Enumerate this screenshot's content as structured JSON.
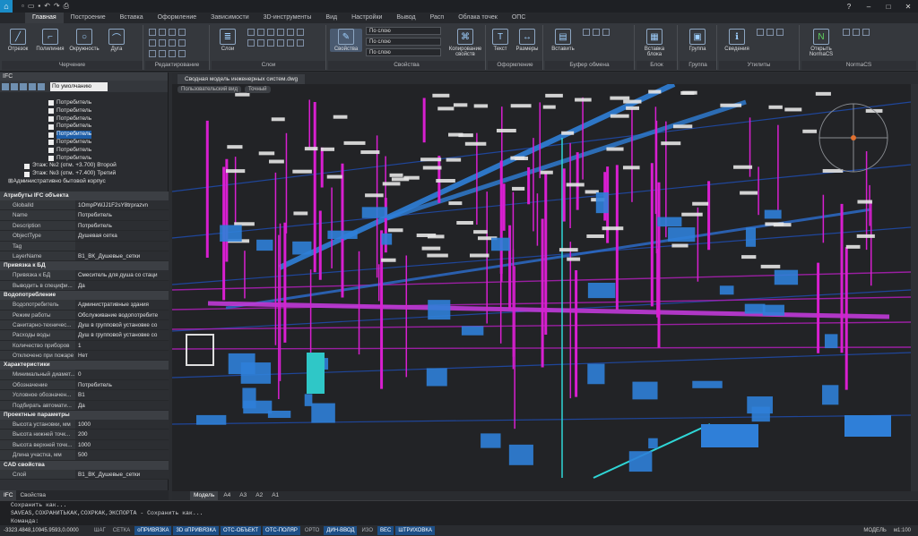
{
  "app": {
    "title": "",
    "help": "?"
  },
  "ribbon_tabs": [
    "Главная",
    "Построение",
    "Вставка",
    "Оформление",
    "Зависимости",
    "3D-инструменты",
    "Вид",
    "Настройки",
    "Вывод",
    "Расп",
    "Облака точек",
    "ОПС"
  ],
  "ribbon_groups": {
    "draw": {
      "label": "Черчение",
      "buttons": [
        "Отрезок",
        "Полилиния",
        "Окружность",
        "Дуга"
      ]
    },
    "edit": {
      "label": "Редактирование"
    },
    "layers": {
      "label": "Слои",
      "button": "Слои"
    },
    "properties": {
      "label": "Свойства",
      "button": "Свойства",
      "dropdowns": [
        "По слою",
        "По слою",
        "По слою"
      ],
      "copy": "Копирование свойств"
    },
    "format": {
      "label": "Оформление",
      "buttons": [
        "Текст",
        "Размеры"
      ]
    },
    "clipboard": {
      "label": "Буфер обмена",
      "buttons": [
        "Вставить"
      ]
    },
    "block": {
      "label": "Блок",
      "buttons": [
        "Вставка блока"
      ]
    },
    "group": {
      "label": "Группа",
      "buttons": [
        "Группа"
      ]
    },
    "utilities": {
      "label": "Утилиты",
      "buttons": [
        "Сведения"
      ]
    },
    "normacs": {
      "label": "NormaCS",
      "buttons": [
        "Открыть NormaCS"
      ]
    }
  },
  "left_panel": {
    "title": "IFC",
    "filter_value": "По умолчанию",
    "tree": [
      {
        "label": "Потребитель",
        "level": 6,
        "checked": true,
        "selected": false
      },
      {
        "label": "Потребитель",
        "level": 6,
        "checked": true,
        "selected": false
      },
      {
        "label": "Потребитель",
        "level": 6,
        "checked": true,
        "selected": false
      },
      {
        "label": "Потребитель",
        "level": 6,
        "checked": true,
        "selected": false
      },
      {
        "label": "Потребитель",
        "level": 6,
        "checked": true,
        "selected": true
      },
      {
        "label": "Потребитель",
        "level": 6,
        "checked": true,
        "selected": false
      },
      {
        "label": "Потребитель",
        "level": 6,
        "checked": true,
        "selected": false
      },
      {
        "label": "Потребитель",
        "level": 6,
        "checked": true,
        "selected": false
      },
      {
        "label": "Этаж: №2 (отм. +3.700) Второй",
        "level": 3,
        "checked": true,
        "selected": false
      },
      {
        "label": "Этаж: №3 (отм. +7.400) Третий",
        "level": 3,
        "checked": true,
        "selected": false
      },
      {
        "label": "Административно бытовой корпус",
        "level": 1,
        "checked": false,
        "selected": false
      }
    ],
    "sections": [
      {
        "title": "Атрибуты IFC объекта",
        "rows": [
          {
            "k": "GlobalId",
            "v": "1OmpPWJJ1F2sY8trprazvn"
          },
          {
            "k": "Name",
            "v": "Потребитель"
          },
          {
            "k": "Description",
            "v": "Потребитель"
          },
          {
            "k": "ObjectType",
            "v": "Душевая сетка"
          },
          {
            "k": "Tag",
            "v": ""
          },
          {
            "k": "LayerName",
            "v": "В1_ВК_Душевые_сетки"
          }
        ]
      },
      {
        "title": "Привязка к БД",
        "rows": [
          {
            "k": "Привязка к БД",
            "v": "Смеситель для душа со стаци"
          },
          {
            "k": "Выводить в специфи...",
            "v": "Да"
          }
        ]
      },
      {
        "title": "Водопотребление",
        "rows": [
          {
            "k": "Водопотребитель",
            "v": "Административные здания"
          },
          {
            "k": "Режим работы",
            "v": "Обслуживание водопотребите"
          },
          {
            "k": "Санитарно-техничес...",
            "v": "Душ в групповой установке со"
          },
          {
            "k": "Расходы воды",
            "v": "Душ в групповой установке со"
          },
          {
            "k": "Количество приборов",
            "v": "1"
          },
          {
            "k": "Отключено при пожаре",
            "v": "Нет"
          }
        ]
      },
      {
        "title": "Характеристики",
        "rows": [
          {
            "k": "Минимальный диамет...",
            "v": "0"
          },
          {
            "k": "Обозначение",
            "v": "Потребитель"
          },
          {
            "k": "Условное обозначен...",
            "v": "В1"
          },
          {
            "k": "Подбирать автомати...",
            "v": "Да"
          }
        ]
      },
      {
        "title": "Проектные параметры",
        "rows": [
          {
            "k": "Высота установки, мм",
            "v": "1000"
          },
          {
            "k": "Высота нижней точк...",
            "v": "200"
          },
          {
            "k": "Высота верхней точк...",
            "v": "1000"
          },
          {
            "k": "Длина участка, мм",
            "v": "500"
          }
        ]
      },
      {
        "title": "CAD свойства",
        "rows": [
          {
            "k": "Слой",
            "v": "В1_ВК_Душевые_сетки"
          }
        ]
      }
    ],
    "footer_tabs": [
      "IFC",
      "Свойства"
    ]
  },
  "document": {
    "tab_title": "Сводная модель инженерных систем.dwg",
    "view_labels": [
      "Пользовательский вид",
      "Точный"
    ]
  },
  "layout_tabs": [
    "Модель",
    "A4",
    "A3",
    "A2",
    "A1"
  ],
  "command": {
    "history1": "Сохранить как...",
    "history2": "SAVEAS,СОХРАНИТЬКАК,СОХРКАК,ЭКСПОРТА - Сохранить как...",
    "prompt": "Команда:"
  },
  "status": {
    "coords": "-3323.4848,10945.9593,0.0000",
    "toggles": [
      {
        "label": "ШАГ",
        "on": false
      },
      {
        "label": "СЕТКА",
        "on": false
      },
      {
        "label": "оПРИВЯЗКА",
        "on": true
      },
      {
        "label": "3D оПРИВЯЗКА",
        "on": true
      },
      {
        "label": "ОТС-ОБЪЕКТ",
        "on": true
      },
      {
        "label": "ОТС-ПОЛЯР",
        "on": true
      },
      {
        "label": "ОРТО",
        "on": false
      },
      {
        "label": "ДИН-ВВОД",
        "on": true
      },
      {
        "label": "ИЗО",
        "on": false
      },
      {
        "label": "ВЕС",
        "on": true
      },
      {
        "label": "ШТРИХОВКА",
        "on": true
      }
    ],
    "model": "МОДЕЛЬ",
    "scale": "м1:100"
  },
  "colors": {
    "accent": "#1a8cc7",
    "selection": "#1e5ea8",
    "pipe_magenta": "#d81fd0",
    "equipment_blue": "#2f7fd8",
    "duct_cyan": "#2fd6d6"
  }
}
